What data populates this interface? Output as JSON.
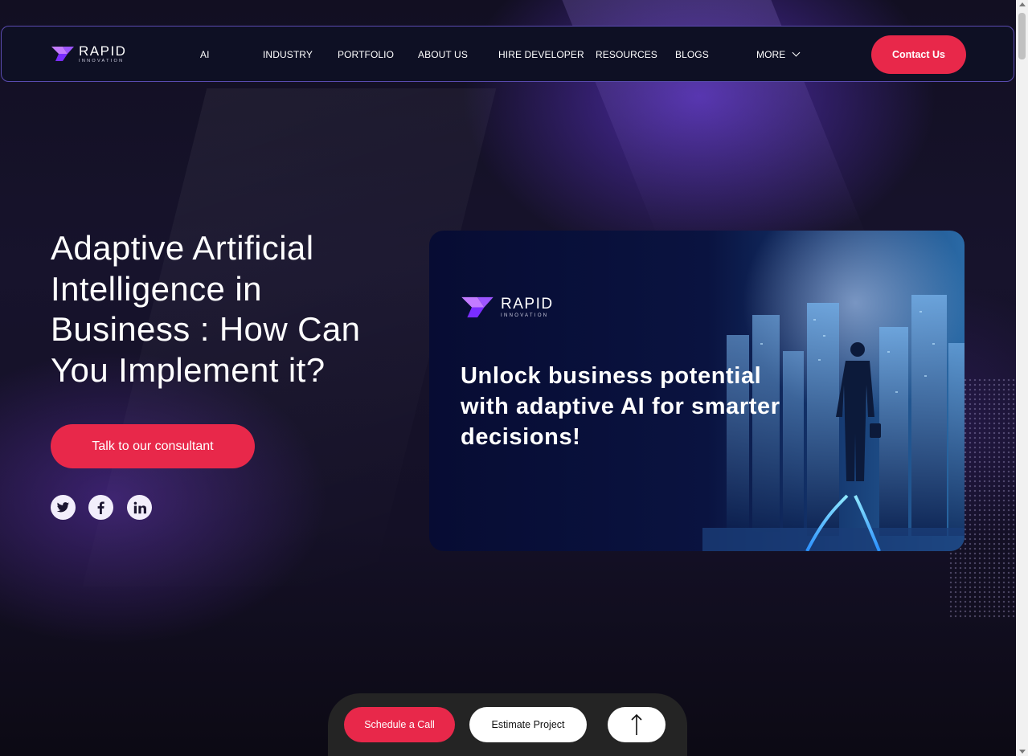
{
  "brand": {
    "name": "RAPID",
    "tagline": "INNOVATION"
  },
  "nav": {
    "items": [
      {
        "label": "AI"
      },
      {
        "label": "INDUSTRY"
      },
      {
        "label": "PORTFOLIO"
      },
      {
        "label": "ABOUT US"
      },
      {
        "label": "HIRE DEVELOPER"
      },
      {
        "label": "RESOURCES"
      },
      {
        "label": "BLOGS"
      },
      {
        "label": "MORE"
      }
    ],
    "contact_label": "Contact Us"
  },
  "hero": {
    "title": "Adaptive Artificial Intelligence in Business : How Can You Implement it?",
    "cta_label": "Talk to our consultant",
    "social": [
      {
        "icon": "twitter-icon"
      },
      {
        "icon": "facebook-icon"
      },
      {
        "icon": "linkedin-icon"
      }
    ]
  },
  "card": {
    "brand_name": "RAPID",
    "brand_tagline": "INNOVATION",
    "headline": "Unlock business potential with adaptive AI for smarter decisions!"
  },
  "action_bar": {
    "schedule_label": "Schedule a Call",
    "estimate_label": "Estimate Project",
    "top_icon": "arrow-up-icon"
  },
  "colors": {
    "accent": "#e8284a",
    "nav_bg": "#0e1024",
    "nav_border": "#5a4bb0",
    "logo_purple": "#8b3dff"
  }
}
